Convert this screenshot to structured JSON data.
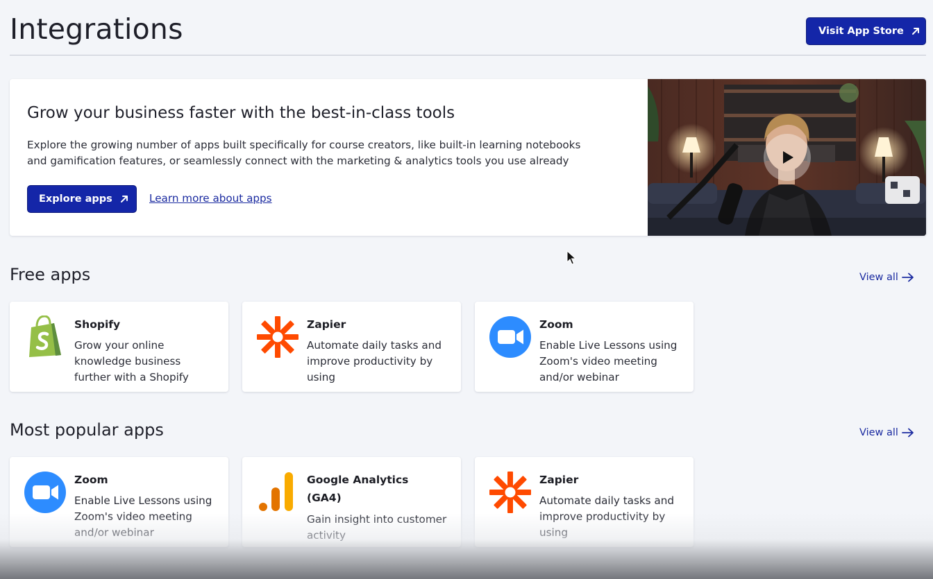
{
  "header": {
    "title": "Integrations",
    "visit_store_label": "Visit App Store"
  },
  "hero": {
    "title": "Grow your business faster with the best-in-class tools",
    "description": "Explore the growing number of apps built specifically for course creators, like built-in learning notebooks and gamification features, or seamlessly connect with the marketing & analytics tools you use already",
    "explore_label": "Explore apps",
    "learn_more_label": "Learn more about apps",
    "video_icon": "play-icon"
  },
  "free_apps": {
    "title": "Free apps",
    "view_all": "View all",
    "cards": [
      {
        "name": "Shopify",
        "description": "Grow your online knowledge business further with a Shopify",
        "icon": "shopify-icon"
      },
      {
        "name": "Zapier",
        "description": "Automate daily tasks and improve productivity by using",
        "icon": "zapier-icon"
      },
      {
        "name": "Zoom",
        "description": "Enable Live Lessons using Zoom's video meeting and/or webinar",
        "icon": "zoom-icon"
      }
    ]
  },
  "popular_apps": {
    "title": "Most popular apps",
    "view_all": "View all",
    "cards": [
      {
        "name": "Zoom",
        "description": "Enable Live Lessons using Zoom's video meeting and/or webinar",
        "icon": "zoom-icon"
      },
      {
        "name": "Google Analytics (GA4)",
        "description": "Gain insight into customer activity",
        "icon": "google-analytics-icon"
      },
      {
        "name": "Zapier",
        "description": "Automate daily tasks and improve productivity by using",
        "icon": "zapier-icon"
      }
    ]
  },
  "colors": {
    "primary": "#1426a8",
    "link": "#1a2aa0",
    "zapier": "#ff4a00",
    "zoom": "#2d8cff",
    "shopify": "#95bf47",
    "ga_orange": "#f9ab00",
    "ga_dark": "#e37400"
  }
}
